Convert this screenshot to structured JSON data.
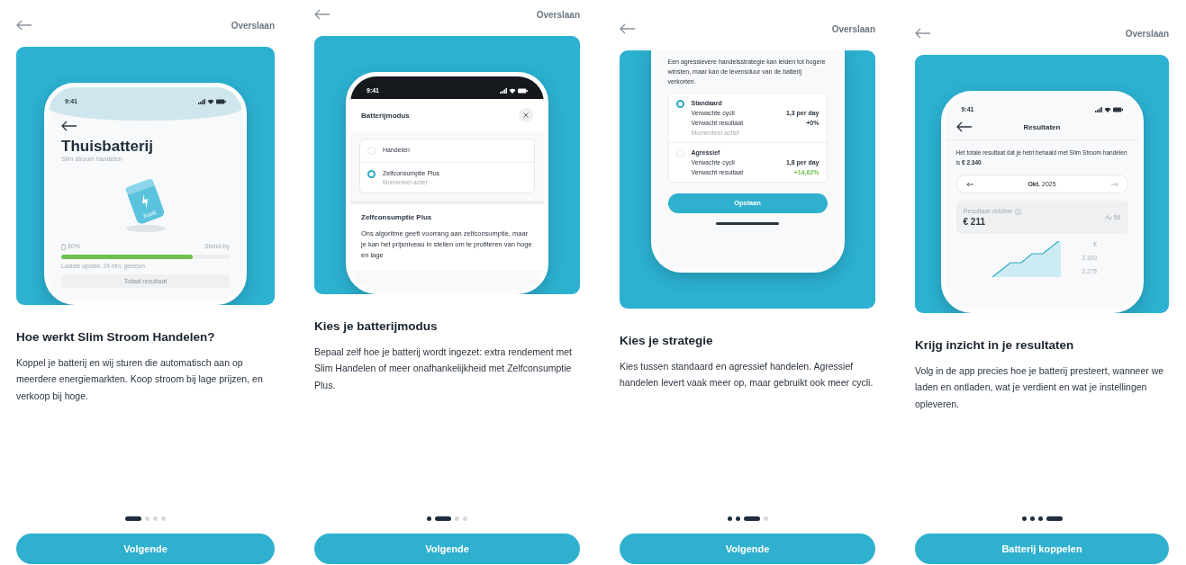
{
  "screens": [
    {
      "skip": "Overslaan",
      "mockup": {
        "kind": "home",
        "time": "9:41",
        "title": "Thuisbatterij",
        "subtitle": "Slim stroom handelen",
        "brand": "frank",
        "charge": "80%",
        "status": "Stand-by",
        "level": 0.78,
        "updated": "Laatste update: 24 min. geleden",
        "card_title": "Totaal resultaat"
      },
      "title": "Hoe werkt Slim Stroom Handelen?",
      "body": "Koppel je batterij en wij sturen die automatisch aan op meerdere energiemarkten. Koop stroom bij lage prijzen, en verkoop bij hoge.",
      "dots": [
        {
          "selected": true,
          "visited": true
        },
        {
          "selected": false,
          "visited": false
        },
        {
          "selected": false,
          "visited": false
        },
        {
          "selected": false,
          "visited": false
        }
      ],
      "button": "Volgende"
    },
    {
      "skip": "Overslaan",
      "mockup": {
        "kind": "mode",
        "time": "9:41",
        "sheet_title": "Batterijmodus",
        "options": [
          {
            "label": "Handelen",
            "selected": false
          },
          {
            "label": "Zelfconsumptie Plus",
            "note": "Momenteel actief",
            "selected": true
          }
        ],
        "section_title": "Zelfconsumptie Plus",
        "section_text": "Ons algoritme geeft voorrang aan zelfconsumptie, maar je kan het prijsniveau in stellen om te profiteren van hoge en lage"
      },
      "title": "Kies je batterijmodus",
      "body": "Bepaal zelf hoe je batterij wordt ingezet: extra rendement met Slim Handelen of meer onafhankelijkheid met Zelfconsumptie Plus.",
      "dots": [
        {
          "selected": false,
          "visited": true
        },
        {
          "selected": true,
          "visited": true
        },
        {
          "selected": false,
          "visited": false
        },
        {
          "selected": false,
          "visited": false
        }
      ],
      "button": "Volgende"
    },
    {
      "skip": "Overslaan",
      "mockup": {
        "kind": "strategy",
        "intro": "Een agressievere handelsstrategie kan leiden tot hogere winsten, maar kan de levensduur van de batterij verkorten.",
        "options": [
          {
            "label": "Standaard",
            "selected": true,
            "note": "Momenteel actief",
            "rows": [
              {
                "label": "Verwachte cycli",
                "value": "1,3 per day",
                "positive": false
              },
              {
                "label": "Verwacht resultaat",
                "value": "+0%",
                "positive": false
              }
            ]
          },
          {
            "label": "Agressief",
            "selected": false,
            "rows": [
              {
                "label": "Verwachte cycli",
                "value": "1,8 per day",
                "positive": false
              },
              {
                "label": "Verwacht resultaat",
                "value": "+14,62%",
                "positive": true
              }
            ]
          }
        ],
        "button": "Opslaan"
      },
      "title": "Kies je strategie",
      "body": "Kies tussen standaard en agressief handelen. Agressief handelen levert vaak meer op, maar gebruikt ook meer cycli.",
      "dots": [
        {
          "selected": false,
          "visited": true
        },
        {
          "selected": false,
          "visited": true
        },
        {
          "selected": true,
          "visited": true
        },
        {
          "selected": false,
          "visited": false
        }
      ],
      "button": "Volgende"
    },
    {
      "skip": "Overslaan",
      "mockup": {
        "kind": "results",
        "time": "9:41",
        "title": "Resultaten",
        "text": "Het totale resultaat dat je hebt behaald met Slim Stroom handelen is **€ 2.340**",
        "month": "**Okt.** 2025",
        "card_label": "Resultaat oktober",
        "card_value": "€ 211",
        "card_side": "56",
        "axis_labels": [
          "€",
          "2.300",
          "2.275"
        ]
      },
      "title": "Krijg inzicht in je resultaten",
      "body": "Volg in de app precies hoe je batterij presteert, wanneer we laden en ontladen, wat je verdient en wat je instellingen opleveren.",
      "dots": [
        {
          "selected": false,
          "visited": true
        },
        {
          "selected": false,
          "visited": true
        },
        {
          "selected": false,
          "visited": true
        },
        {
          "selected": true,
          "visited": true
        }
      ],
      "button": "Batterij koppelen"
    }
  ]
}
